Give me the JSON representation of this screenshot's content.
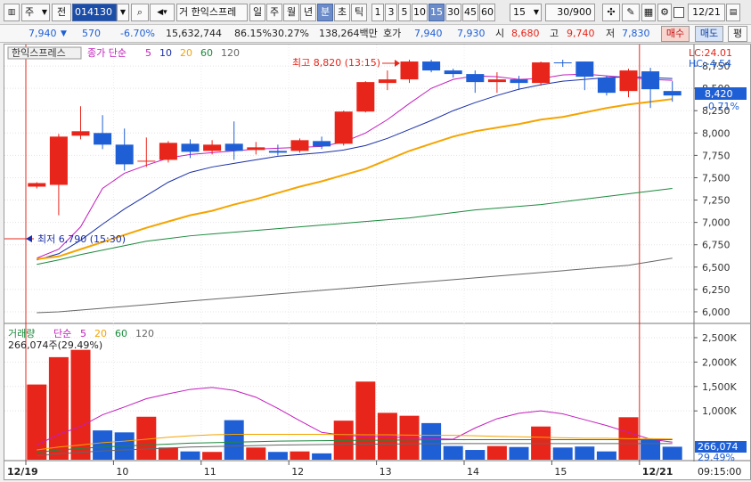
{
  "toolbar": {
    "stock_type": "주",
    "prev_label": "전",
    "code": "014130",
    "stock_name_short": "거 한익스프레",
    "period_buttons": [
      "일",
      "주",
      "월",
      "년",
      "분",
      "초",
      "틱"
    ],
    "minute_buttons": [
      "1",
      "3",
      "5",
      "10",
      "15",
      "30",
      "45",
      "60"
    ],
    "active_period": "분",
    "active_minute": "15",
    "interval_value": "15",
    "count": "30/900",
    "date": "12/21"
  },
  "quote": {
    "price": "7,940",
    "change": "570",
    "change_pct": "-6.70%",
    "volume": "15,632,744",
    "vol_ratio": "86.15%",
    "turnover": "30.27%",
    "amount": "138,264백만",
    "bid_label": "호가",
    "ask_price": "7,940",
    "bid_price": "7,930",
    "open_label": "시",
    "open": "8,680",
    "high_label": "고",
    "high": "9,740",
    "low_label": "저",
    "low": "7,830",
    "buy_label": "매수",
    "sell_label": "매도",
    "eval_label": "평"
  },
  "price_panel": {
    "stock_name": "한익스프레스",
    "ma_label": "종가 단순",
    "ma_periods": [
      "5",
      "10",
      "20",
      "60",
      "120"
    ],
    "ma_colors": [
      "#c21dbd",
      "#1a2fa8",
      "#f5a400",
      "#1a8a3c",
      "#666666"
    ],
    "lc_label": "LC:24.01",
    "hc_label": "HC:-4.54",
    "high_note": "최고 8,820 (13:15)",
    "low_note": "최저 6,790 (15:30)",
    "current_price_tag": "8,420",
    "current_pct_tag": "-0.71%",
    "axis_ticks": [
      "8,750",
      "8,500",
      "8,250",
      "8,000",
      "7,750",
      "7,500",
      "7,250",
      "7,000",
      "6,750",
      "6,500",
      "6,250",
      "6,000"
    ]
  },
  "volume_panel": {
    "label": "거래량",
    "ma_label": "단순",
    "ma_periods": [
      "5",
      "20",
      "60",
      "120"
    ],
    "current_volume_label": "266,074주(29.49%)",
    "axis_ticks": [
      "2,500K",
      "2,000K",
      "1,500K",
      "1,000K"
    ],
    "last_volume_tag": "266,074",
    "last_pct_tag": "29.49%"
  },
  "x_axis": {
    "labels": [
      "12/19",
      "10",
      "11",
      "12",
      "13",
      "14",
      "15",
      "12/21"
    ],
    "time": "09:15:00"
  },
  "chart_data": {
    "type": "candlestick",
    "price_range": [
      5900,
      8950
    ],
    "volume_range": [
      0,
      2700
    ],
    "volume_unit": "K",
    "bullish_color": "#e8251a",
    "bearish_color": "#1f5fd6",
    "candles": [
      {
        "o": 7400,
        "h": 7450,
        "l": 7380,
        "c": 7440,
        "v": 1540
      },
      {
        "o": 7420,
        "h": 7990,
        "l": 7080,
        "c": 7960,
        "v": 2100
      },
      {
        "o": 7970,
        "h": 8300,
        "l": 7930,
        "c": 8020,
        "v": 2250
      },
      {
        "o": 8000,
        "h": 8200,
        "l": 7820,
        "c": 7870,
        "v": 600
      },
      {
        "o": 7870,
        "h": 8050,
        "l": 7580,
        "c": 7650,
        "v": 560
      },
      {
        "o": 7680,
        "h": 7950,
        "l": 7620,
        "c": 7690,
        "v": 880
      },
      {
        "o": 7700,
        "h": 7910,
        "l": 7670,
        "c": 7890,
        "v": 250
      },
      {
        "o": 7880,
        "h": 7930,
        "l": 7720,
        "c": 7790,
        "v": 170
      },
      {
        "o": 7800,
        "h": 7920,
        "l": 7760,
        "c": 7870,
        "v": 160
      },
      {
        "o": 7880,
        "h": 8130,
        "l": 7700,
        "c": 7800,
        "v": 810
      },
      {
        "o": 7810,
        "h": 7900,
        "l": 7760,
        "c": 7840,
        "v": 250
      },
      {
        "o": 7800,
        "h": 7870,
        "l": 7750,
        "c": 7780,
        "v": 160
      },
      {
        "o": 7800,
        "h": 7940,
        "l": 7780,
        "c": 7920,
        "v": 170
      },
      {
        "o": 7910,
        "h": 7960,
        "l": 7820,
        "c": 7850,
        "v": 130
      },
      {
        "o": 7880,
        "h": 8250,
        "l": 7860,
        "c": 8240,
        "v": 800
      },
      {
        "o": 8240,
        "h": 8580,
        "l": 8230,
        "c": 8570,
        "v": 1600
      },
      {
        "o": 8560,
        "h": 8700,
        "l": 8480,
        "c": 8600,
        "v": 960
      },
      {
        "o": 8600,
        "h": 8820,
        "l": 8560,
        "c": 8800,
        "v": 900
      },
      {
        "o": 8800,
        "h": 8820,
        "l": 8680,
        "c": 8700,
        "v": 750
      },
      {
        "o": 8700,
        "h": 8720,
        "l": 8620,
        "c": 8660,
        "v": 280
      },
      {
        "o": 8660,
        "h": 8700,
        "l": 8450,
        "c": 8570,
        "v": 200
      },
      {
        "o": 8570,
        "h": 8680,
        "l": 8450,
        "c": 8600,
        "v": 280
      },
      {
        "o": 8600,
        "h": 8640,
        "l": 8480,
        "c": 8560,
        "v": 260
      },
      {
        "o": 8560,
        "h": 8800,
        "l": 8530,
        "c": 8790,
        "v": 680
      },
      {
        "o": 8790,
        "h": 8820,
        "l": 8740,
        "c": 8780,
        "v": 250
      },
      {
        "o": 8800,
        "h": 8800,
        "l": 8480,
        "c": 8630,
        "v": 270
      },
      {
        "o": 8620,
        "h": 8640,
        "l": 8420,
        "c": 8450,
        "v": 170
      },
      {
        "o": 8470,
        "h": 8720,
        "l": 8400,
        "c": 8700,
        "v": 870
      },
      {
        "o": 8690,
        "h": 8730,
        "l": 8280,
        "c": 8490,
        "v": 420
      },
      {
        "o": 8470,
        "h": 8580,
        "l": 8350,
        "c": 8420,
        "v": 266
      }
    ],
    "price_ma": {
      "5": [
        6600,
        6700,
        6950,
        7380,
        7550,
        7640,
        7720,
        7760,
        7780,
        7800,
        7820,
        7830,
        7840,
        7850,
        7900,
        8000,
        8150,
        8330,
        8500,
        8600,
        8640,
        8630,
        8600,
        8610,
        8650,
        8660,
        8640,
        8620,
        8600,
        8590
      ],
      "10": [
        6580,
        6650,
        6800,
        6980,
        7150,
        7300,
        7450,
        7560,
        7620,
        7660,
        7700,
        7740,
        7760,
        7780,
        7810,
        7860,
        7940,
        8040,
        8140,
        8250,
        8340,
        8420,
        8490,
        8540,
        8580,
        8600,
        8620,
        8630,
        8620,
        8610
      ],
      "20": [
        6590,
        6620,
        6700,
        6780,
        6860,
        6940,
        7010,
        7080,
        7130,
        7200,
        7260,
        7330,
        7400,
        7460,
        7530,
        7600,
        7700,
        7800,
        7880,
        7960,
        8020,
        8060,
        8100,
        8150,
        8180,
        8230,
        8280,
        8320,
        8350,
        8380
      ],
      "60": [
        6530,
        6580,
        6640,
        6690,
        6740,
        6790,
        6820,
        6850,
        6870,
        6890,
        6910,
        6930,
        6950,
        6970,
        6990,
        7010,
        7030,
        7050,
        7080,
        7110,
        7140,
        7160,
        7180,
        7200,
        7230,
        7260,
        7290,
        7320,
        7350,
        7380
      ],
      "120": [
        5990,
        6000,
        6020,
        6040,
        6060,
        6080,
        6100,
        6120,
        6140,
        6160,
        6180,
        6200,
        6220,
        6240,
        6260,
        6280,
        6300,
        6320,
        6340,
        6360,
        6380,
        6400,
        6420,
        6440,
        6460,
        6480,
        6500,
        6520,
        6560,
        6600
      ]
    },
    "volume_ma": {
      "5": [
        300,
        520,
        680,
        920,
        1080,
        1250,
        1350,
        1440,
        1480,
        1420,
        1280,
        1050,
        800,
        560,
        500,
        480,
        470,
        450,
        430,
        420,
        650,
        840,
        950,
        1000,
        940,
        820,
        700,
        560,
        420,
        360
      ],
      "20": [
        200,
        260,
        300,
        350,
        380,
        420,
        460,
        490,
        510,
        520,
        520,
        520,
        520,
        520,
        515,
        510,
        510,
        505,
        500,
        500,
        490,
        480,
        470,
        460,
        450,
        440,
        440,
        430,
        430,
        425
      ],
      "60": [
        150,
        200,
        230,
        260,
        280,
        300,
        320,
        340,
        350,
        360,
        370,
        380,
        385,
        390,
        395,
        400,
        400,
        405,
        405,
        410,
        410,
        410,
        410,
        410,
        410,
        410,
        410,
        410,
        410,
        410
      ],
      "120": [
        80,
        120,
        150,
        180,
        200,
        220,
        240,
        260,
        270,
        280,
        290,
        300,
        305,
        310,
        315,
        320,
        320,
        325,
        325,
        330,
        330,
        330,
        330,
        330,
        330,
        330,
        330,
        330,
        330,
        330
      ]
    },
    "x_label_positions": [
      0,
      4,
      8,
      12,
      16,
      20,
      24,
      28
    ]
  }
}
